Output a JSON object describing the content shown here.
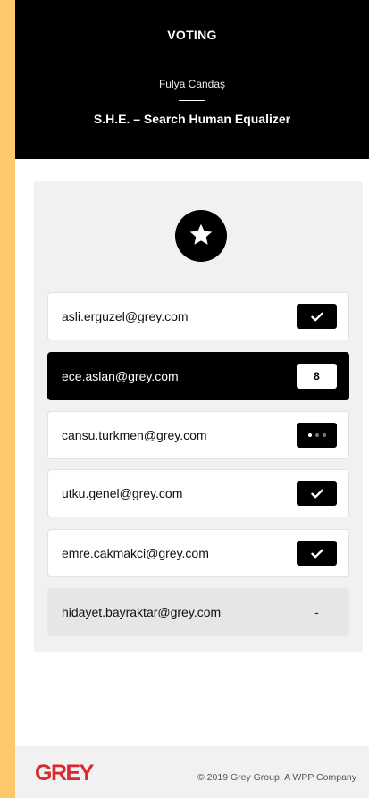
{
  "header": {
    "title": "VOTING",
    "user_name": "Fulya Candaş",
    "project_title": "S.H.E. – Search Human Equalizer"
  },
  "badge": {
    "icon": "star-icon"
  },
  "voters": [
    {
      "email": "asli.erguzel@grey.com",
      "status": "voted",
      "icon": "check-icon"
    },
    {
      "email": "ece.aslan@grey.com",
      "status": "score",
      "value": "8"
    },
    {
      "email": "cansu.turkmen@grey.com",
      "status": "in-progress",
      "icon": "dots-icon"
    },
    {
      "email": "utku.genel@grey.com",
      "status": "voted",
      "icon": "check-icon"
    },
    {
      "email": "emre.cakmakci@grey.com",
      "status": "voted",
      "icon": "check-icon"
    },
    {
      "email": "hidayet.bayraktar@grey.com",
      "status": "pending",
      "value": "-"
    }
  ],
  "footer": {
    "logo": "GREY",
    "copyright": "© 2019 Grey Group. A WPP Company"
  },
  "colors": {
    "background": "#fcc96a",
    "header": "#000000",
    "accent": "#d8292f"
  }
}
